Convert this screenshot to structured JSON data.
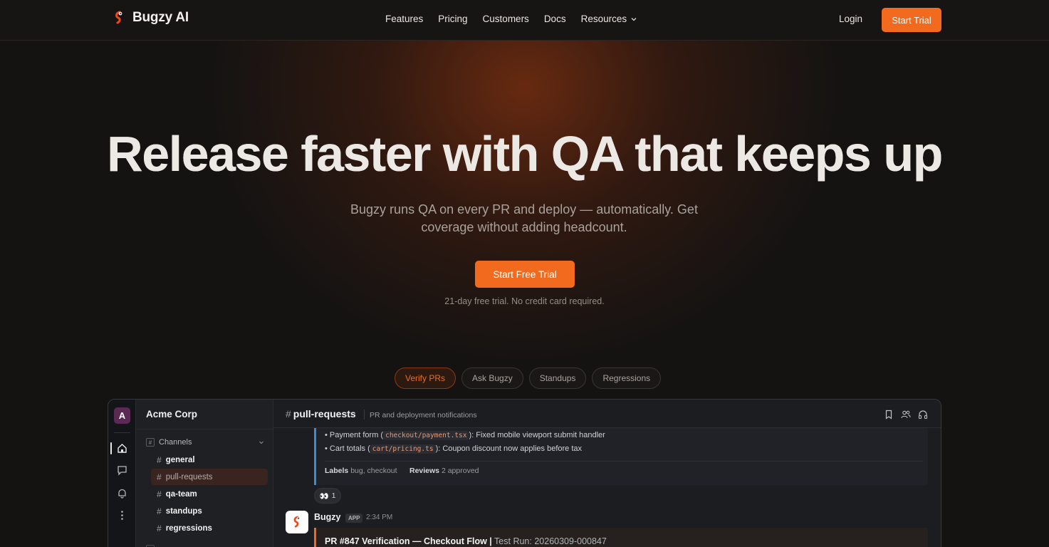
{
  "brand": {
    "name": "Bugzy AI"
  },
  "nav": {
    "links": [
      "Features",
      "Pricing",
      "Customers",
      "Docs"
    ],
    "resources_label": "Resources",
    "login_label": "Login",
    "start_trial_label": "Start Trial"
  },
  "hero": {
    "title": "Release faster with QA that keeps up",
    "subtitle": "Bugzy runs QA on every PR and deploy — automatically. Get coverage without adding headcount.",
    "cta_label": "Start Free Trial",
    "note": "21-day free trial. No credit card required."
  },
  "demo_tabs": [
    "Verify PRs",
    "Ask Bugzy",
    "Standups",
    "Regressions"
  ],
  "active_tab": "Verify PRs",
  "colors": {
    "accent": "#f26a1e",
    "info_bar": "#3a8fd0",
    "background": "#151312"
  },
  "app": {
    "workspace_initial": "A",
    "workspace_name": "Acme Corp",
    "channels_section_label": "Channels",
    "channels": [
      "general",
      "pull-requests",
      "qa-team",
      "standups",
      "regressions"
    ],
    "active_channel": "pull-requests",
    "channel_header": {
      "name": "pull-requests",
      "description": "PR and deployment notifications"
    },
    "message": {
      "bullets": [
        {
          "prefix": "• Payment form (",
          "code": "checkout/payment.tsx",
          "suffix": "): Fixed mobile viewport submit handler"
        },
        {
          "prefix": "• Cart totals (",
          "code": "cart/pricing.ts",
          "suffix": "): Coupon discount now applies before tax"
        }
      ],
      "labels_key": "Labels",
      "labels_value": "bug, checkout",
      "reviews_key": "Reviews",
      "reviews_value": "2 approved",
      "reaction_emoji": "👀",
      "reaction_count": "1"
    },
    "bot_message": {
      "name": "Bugzy",
      "badge": "APP",
      "time": "2:34 PM",
      "title_bold": "PR #847 Verification — Checkout Flow |",
      "title_rest": " Test Run: 20260309-000847"
    }
  }
}
